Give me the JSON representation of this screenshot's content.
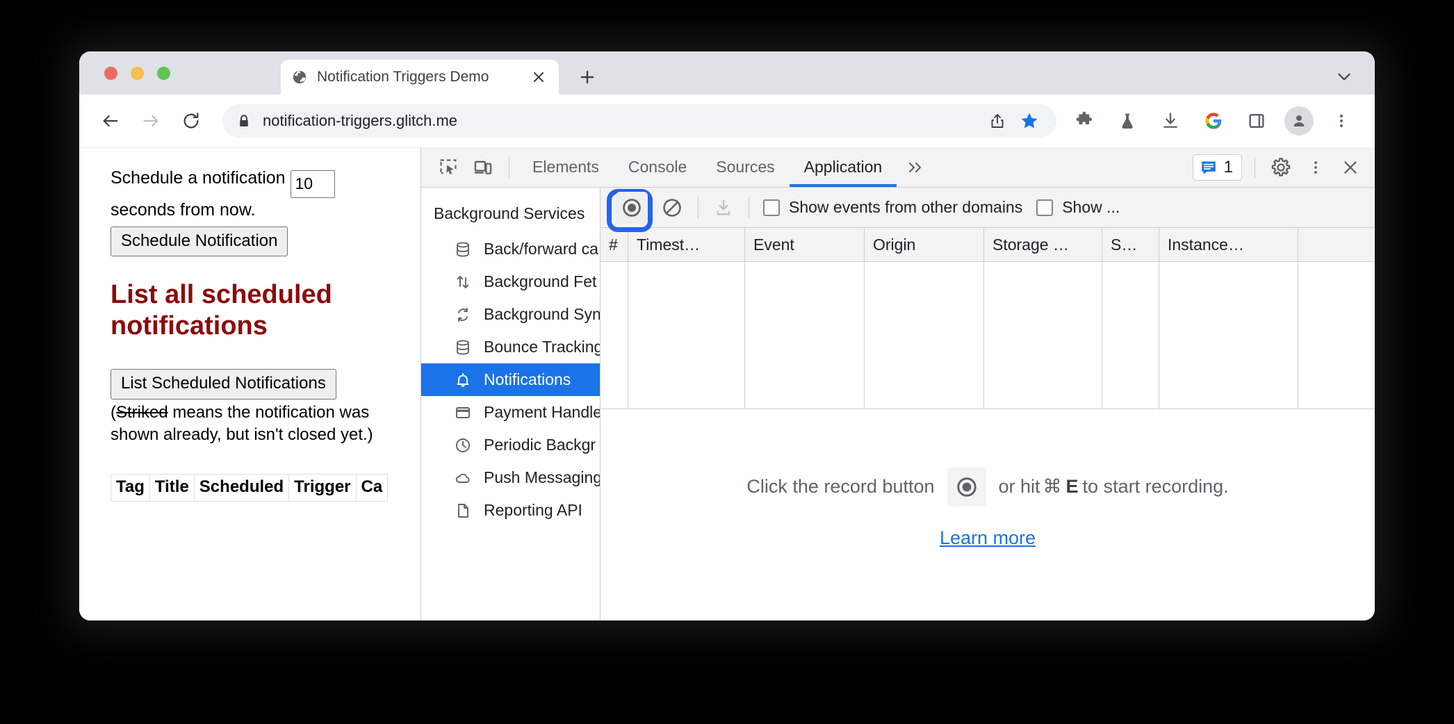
{
  "window": {
    "traffic_lights": [
      "close",
      "minimize",
      "maximize"
    ]
  },
  "tabstrip": {
    "tab": {
      "title": "Notification Triggers Demo",
      "favicon": "globe-icon",
      "close": "×"
    },
    "new_tab": "+",
    "chevron": "⌄"
  },
  "toolbar": {
    "back": "←",
    "forward": "→",
    "reload": "⟳",
    "lock": "lock-icon",
    "url": "notification-triggers.glitch.me",
    "icons": [
      "share-icon",
      "bookmark-star-icon",
      "extensions-puzzle-icon",
      "labs-flask-icon",
      "downloads-icon",
      "google-g-icon",
      "side-panel-icon",
      "profile-avatar-icon",
      "chrome-menu-icon"
    ]
  },
  "page": {
    "schedule_prefix": "Schedule a notification",
    "seconds_value": "10",
    "schedule_suffix": "seconds from now.",
    "schedule_button": "Schedule Notification",
    "heading": "List all scheduled notifications",
    "heading_color": "#8b0b0b",
    "list_button": "List Scheduled Notifications",
    "note_open": "(",
    "note_strike": "Striked",
    "note_rest": " means the notification was shown already, but isn't closed yet.)",
    "table_headers": [
      "Tag",
      "Title",
      "Scheduled",
      "Trigger",
      "Ca"
    ]
  },
  "devtools": {
    "inspect_icon": "inspect-element-icon",
    "device_icon": "device-toolbar-icon",
    "tabs": [
      {
        "label": "Elements",
        "active": false
      },
      {
        "label": "Console",
        "active": false
      },
      {
        "label": "Sources",
        "active": false
      },
      {
        "label": "Application",
        "active": true
      }
    ],
    "overflow": "»",
    "message_badge": {
      "icon": "message-icon",
      "count": "1",
      "color": "#1a73e8"
    },
    "settings_icon": "gear-icon",
    "more_icon": "more-vertical-icon",
    "close_icon": "close-icon",
    "sidebar": {
      "section_title": "Background Services",
      "items": [
        {
          "label": "Back/forward ca",
          "icon": "database-icon",
          "selected": false
        },
        {
          "label": "Background Fet",
          "icon": "background-fetch-icon",
          "selected": false
        },
        {
          "label": "Background Syn",
          "icon": "sync-icon",
          "selected": false
        },
        {
          "label": "Bounce Tracking",
          "icon": "database-icon",
          "selected": false
        },
        {
          "label": "Notifications",
          "icon": "bell-icon",
          "selected": true
        },
        {
          "label": "Payment Handle",
          "icon": "credit-card-icon",
          "selected": false
        },
        {
          "label": "Periodic Backgr",
          "icon": "clock-icon",
          "selected": false
        },
        {
          "label": "Push Messaging",
          "icon": "cloud-icon",
          "selected": false
        },
        {
          "label": "Reporting API",
          "icon": "document-icon",
          "selected": false
        }
      ],
      "selected_color": "#1a73e8"
    },
    "panel_toolbar": {
      "record_button": "record-icon",
      "record_highlight_color": "#2563eb",
      "clear_button": "clear-circle-slash-icon",
      "download_button": "download-icon",
      "checkbox_other_domains": "Show events from other domains",
      "checkbox_other_domains_checked": false,
      "checkbox_show_more": "Show ...",
      "checkbox_show_more_checked": false
    },
    "grid": {
      "columns": [
        "#",
        "Timest…",
        "Event",
        "Origin",
        "Storage …",
        "S…",
        "Instance…"
      ],
      "rows": []
    },
    "empty_state": {
      "prefix": "Click the record button",
      "record_icon": "record-icon",
      "middle": "or hit",
      "cmd_key": "⌘",
      "letter_key": "E",
      "suffix": "to start recording.",
      "learn_more": "Learn more",
      "link_color": "#1a73e8"
    }
  }
}
